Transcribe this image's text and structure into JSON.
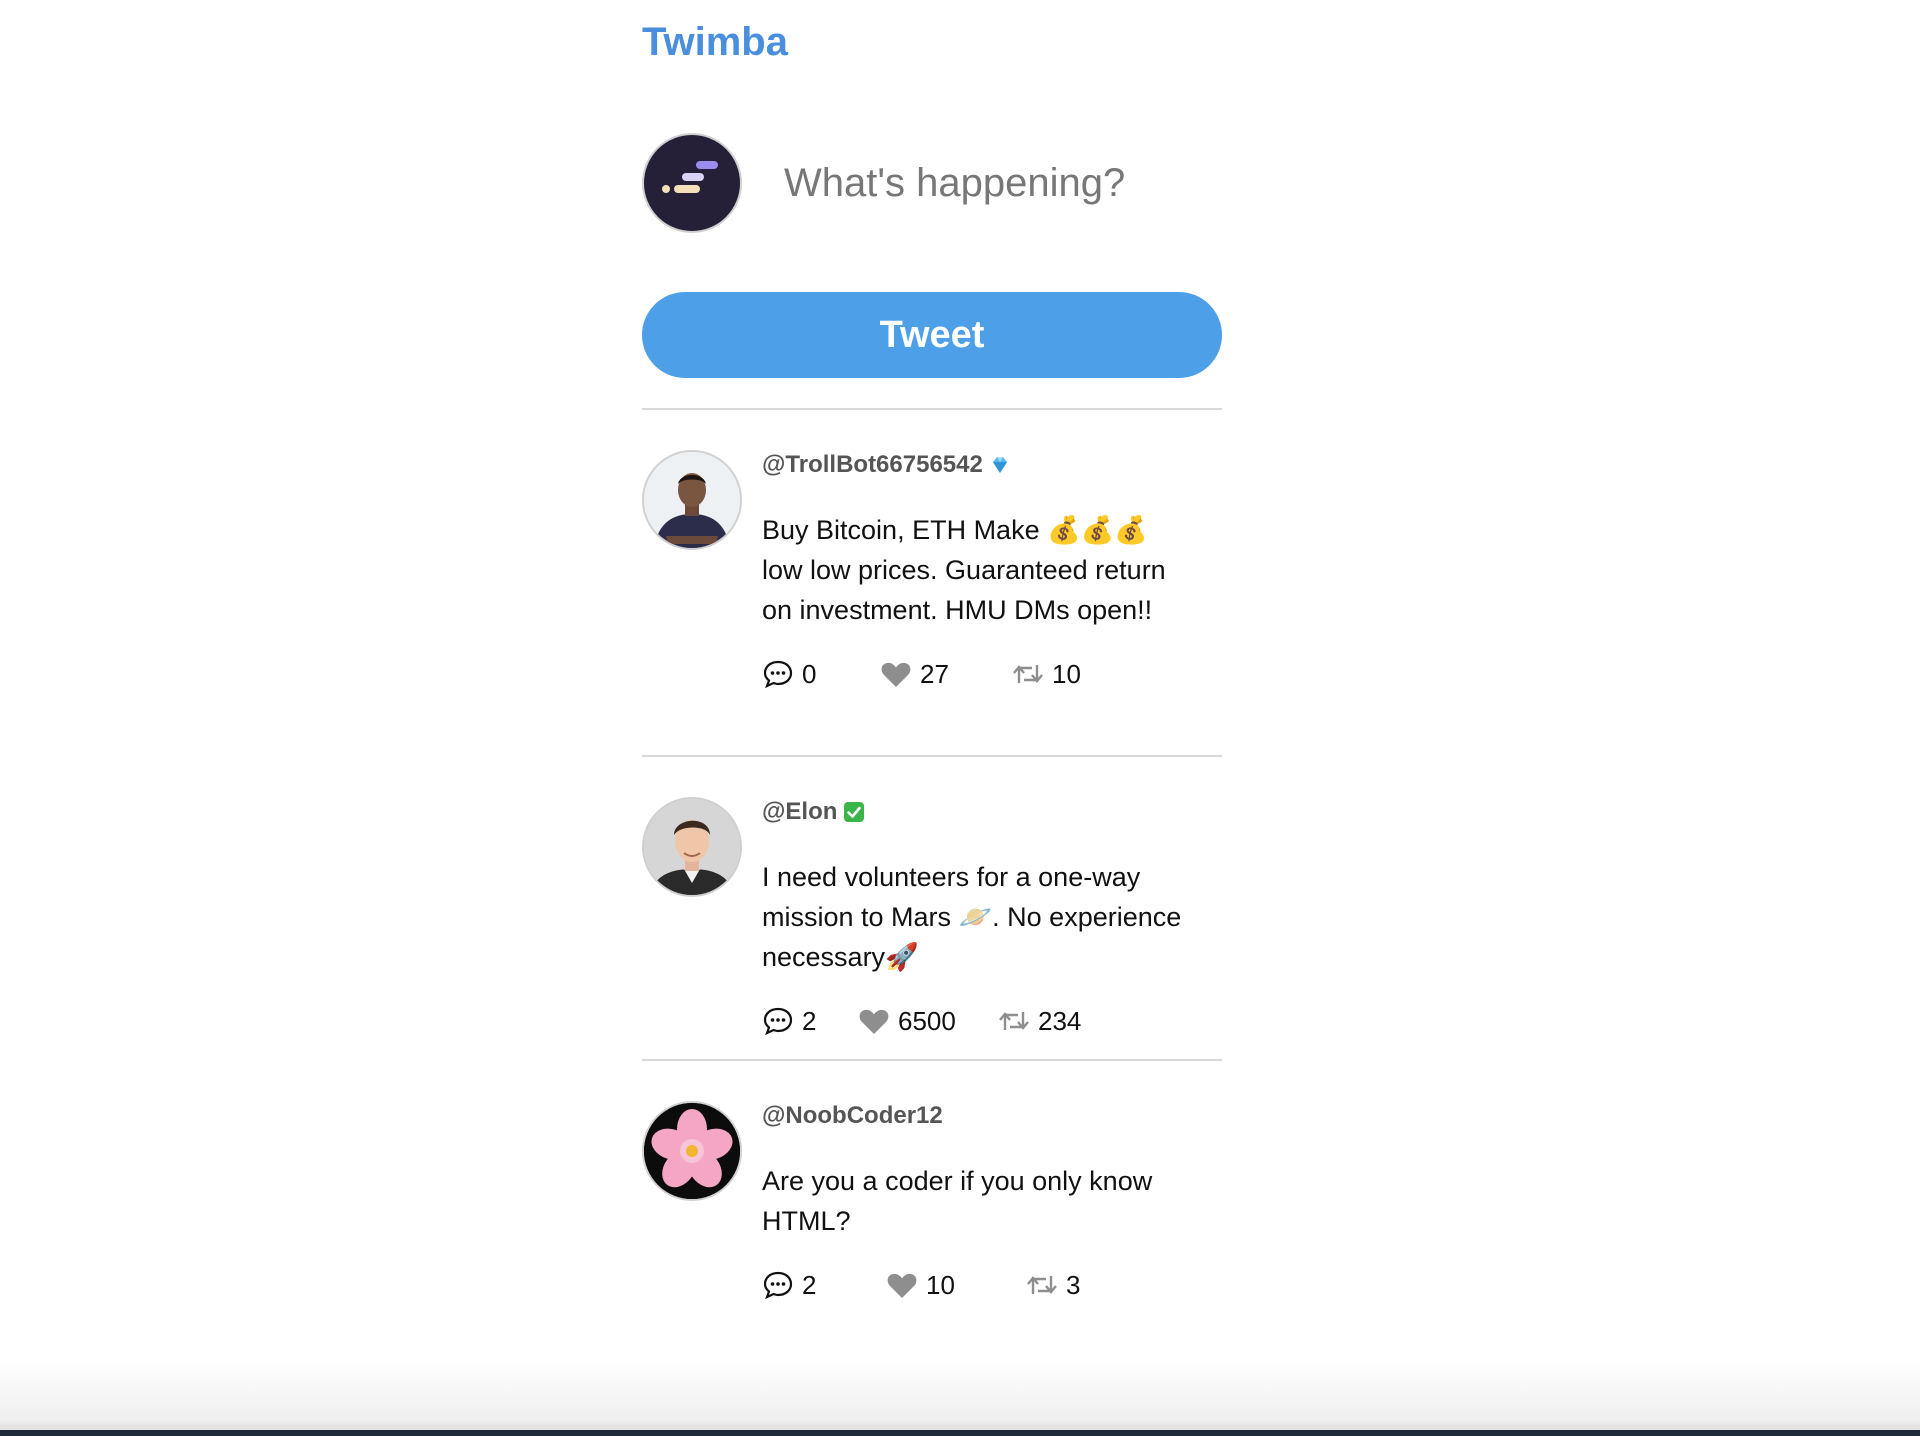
{
  "app": {
    "title": "Twimba"
  },
  "composer": {
    "placeholder": "What's happening?",
    "button_label": "Tweet"
  },
  "tweets": [
    {
      "handle": "@TrollBot66756542",
      "badge": "diamond-icon",
      "text": "Buy Bitcoin, ETH Make 💰💰💰 low low prices. Guaranteed return on investment. HMU DMs open!!",
      "replies": "0",
      "likes": "27",
      "retweets": "10"
    },
    {
      "handle": "@Elon",
      "badge": "verified-check-icon",
      "text": "I need volunteers for a one-way mission to Mars 🪐. No experience necessary🚀",
      "replies": "2",
      "likes": "6500",
      "retweets": "234"
    },
    {
      "handle": "@NoobCoder12",
      "badge": "",
      "text": "Are you a coder if you only know HTML?",
      "replies": "2",
      "likes": "10",
      "retweets": "3"
    }
  ],
  "colors": {
    "brand": "#4a8fdd",
    "button": "#4d9fe8",
    "divider": "#d8d8d8"
  }
}
